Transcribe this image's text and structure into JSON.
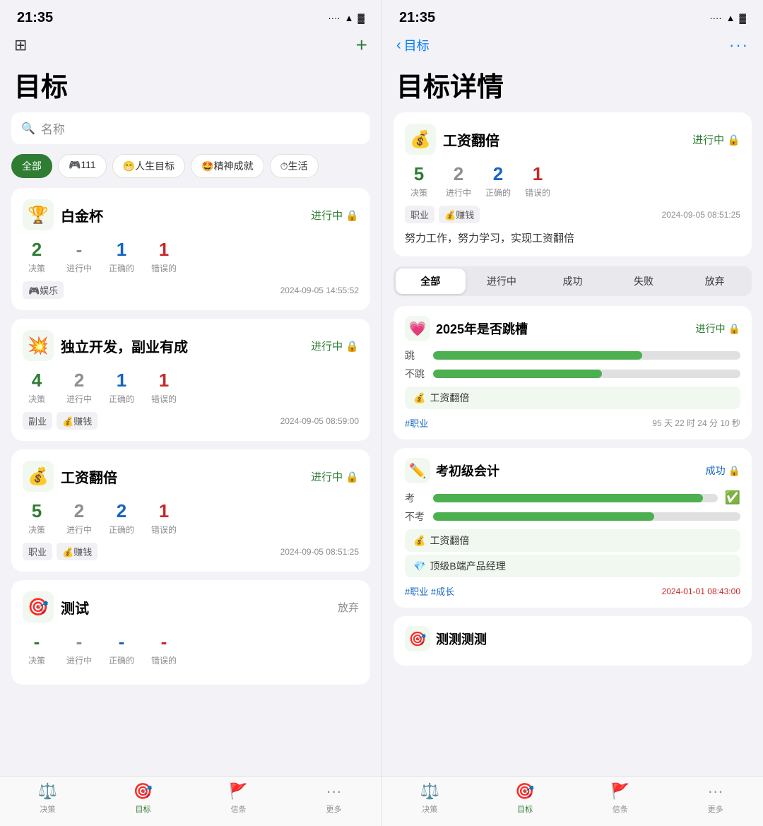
{
  "left": {
    "status_time": "21:35",
    "header": {
      "filter_icon": "⚙",
      "add_icon": "+",
      "title": "目标"
    },
    "search": {
      "placeholder": "名称"
    },
    "filter_tabs": [
      {
        "label": "全部",
        "active": true
      },
      {
        "label": "🎮111",
        "active": false
      },
      {
        "label": "😁人生目标",
        "active": false
      },
      {
        "label": "🤩精神成就",
        "active": false
      },
      {
        "label": "⏱生活",
        "active": false
      }
    ],
    "cards": [
      {
        "emoji": "🏆",
        "name": "白金杯",
        "status": "进行中",
        "stats": [
          {
            "value": "2",
            "label": "决策",
            "color": "green"
          },
          {
            "value": "-",
            "label": "进行中",
            "color": "gray"
          },
          {
            "value": "1",
            "label": "正确的",
            "color": "blue"
          },
          {
            "value": "1",
            "label": "错误的",
            "color": "red"
          }
        ],
        "tags": [
          "娱乐"
        ],
        "date": "2024-09-05 14:55:52",
        "abandon": false
      },
      {
        "emoji": "💥",
        "name": "独立开发，副业有成",
        "status": "进行中",
        "stats": [
          {
            "value": "4",
            "label": "决策",
            "color": "green"
          },
          {
            "value": "2",
            "label": "进行中",
            "color": "gray"
          },
          {
            "value": "1",
            "label": "正确的",
            "color": "blue"
          },
          {
            "value": "1",
            "label": "错误的",
            "color": "red"
          }
        ],
        "tags": [
          "副业",
          "💰赚钱"
        ],
        "date": "2024-09-05 08:59:00",
        "abandon": false
      },
      {
        "emoji": "💰",
        "name": "工资翻倍",
        "status": "进行中",
        "stats": [
          {
            "value": "5",
            "label": "决策",
            "color": "green"
          },
          {
            "value": "2",
            "label": "进行中",
            "color": "gray"
          },
          {
            "value": "2",
            "label": "正确的",
            "color": "blue"
          },
          {
            "value": "1",
            "label": "错误的",
            "color": "red"
          }
        ],
        "tags": [
          "职业",
          "💰赚钱"
        ],
        "date": "2024-09-05 08:51:25",
        "abandon": false
      },
      {
        "emoji": "🎯",
        "name": "测试",
        "status": "放弃",
        "stats": [
          {
            "value": "-",
            "label": "决策",
            "color": "green"
          },
          {
            "value": "-",
            "label": "进行中",
            "color": "gray"
          },
          {
            "value": "-",
            "label": "正确的",
            "color": "blue"
          },
          {
            "value": "-",
            "label": "错误的",
            "color": "red"
          }
        ],
        "tags": [],
        "date": "",
        "abandon": true
      }
    ],
    "bottom_nav": [
      {
        "icon": "⚖️",
        "label": "决策",
        "active": false
      },
      {
        "icon": "🎯",
        "label": "目标",
        "active": true
      },
      {
        "icon": "🚩",
        "label": "信条",
        "active": false
      },
      {
        "icon": "···",
        "label": "更多",
        "active": false
      }
    ]
  },
  "right": {
    "status_time": "21:35",
    "header": {
      "back_label": "目标",
      "more_icon": "···"
    },
    "page_title": "目标详情",
    "detail_card": {
      "emoji": "💰",
      "name": "工资翻倍",
      "status": "进行中",
      "stats": [
        {
          "value": "5",
          "label": "决策",
          "color": "green"
        },
        {
          "value": "2",
          "label": "进行中",
          "color": "gray"
        },
        {
          "value": "2",
          "label": "正确的",
          "color": "blue"
        },
        {
          "value": "1",
          "label": "错误的",
          "color": "red"
        }
      ],
      "tags": [
        "职业",
        "💰赚钱"
      ],
      "date": "2024-09-05 08:51:25",
      "description": "努力工作，努力学习，实现工资翻倍"
    },
    "filter_tabs": [
      {
        "label": "全部",
        "active": true
      },
      {
        "label": "进行中",
        "active": false
      },
      {
        "label": "成功",
        "active": false
      },
      {
        "label": "失败",
        "active": false
      },
      {
        "label": "放弃",
        "active": false
      }
    ],
    "decisions": [
      {
        "emoji": "💗",
        "name": "2025年是否跳槽",
        "status": "进行中",
        "options": [
          {
            "label": "跳",
            "progress": 68
          },
          {
            "label": "不跳",
            "progress": 55
          }
        ],
        "parent": "💰 工资翻倍",
        "hashtags": "#职业",
        "time": "95 天 22 时 24 分 10 秒",
        "time_red": false
      },
      {
        "emoji": "✏️",
        "name": "考初级会计",
        "status": "成功",
        "options": [
          {
            "label": "考",
            "progress": 95
          },
          {
            "label": "不考",
            "progress": 72
          }
        ],
        "parents": [
          "💰 工资翻倍",
          "💎 顶级B端产品经理"
        ],
        "hashtags": "#职业 #成长",
        "time": "2024-01-01 08:43:00",
        "time_red": true
      }
    ],
    "truncated": {
      "emoji": "🎯",
      "name": "测测测测"
    },
    "bottom_nav": [
      {
        "icon": "⚖️",
        "label": "决策",
        "active": false
      },
      {
        "icon": "🎯",
        "label": "目标",
        "active": true
      },
      {
        "icon": "🚩",
        "label": "信条",
        "active": false
      },
      {
        "icon": "···",
        "label": "更多",
        "active": false
      }
    ]
  }
}
